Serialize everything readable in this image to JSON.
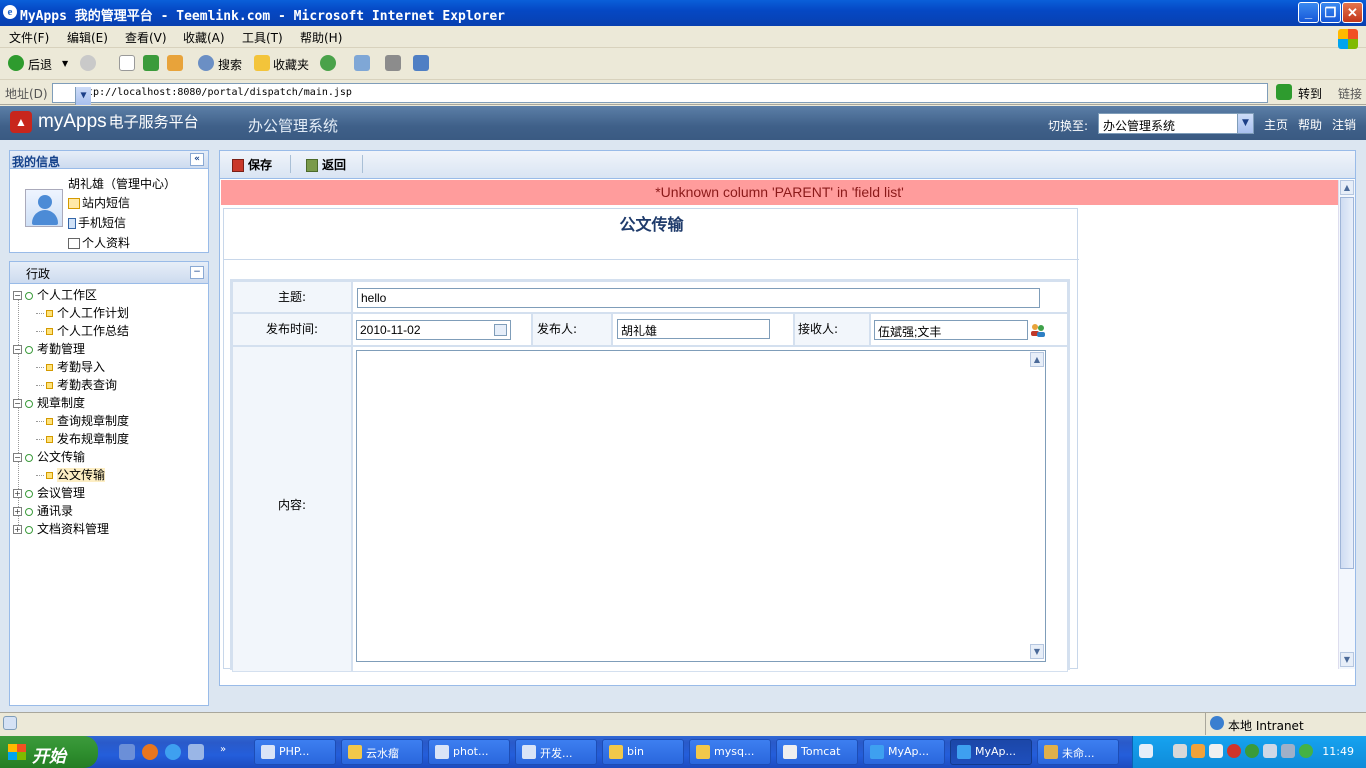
{
  "window": {
    "title": "MyApps 我的管理平台 - Teemlink.com - Microsoft Internet Explorer"
  },
  "menu": [
    "文件(F)",
    "编辑(E)",
    "查看(V)",
    "收藏(A)",
    "工具(T)",
    "帮助(H)"
  ],
  "toolbar": {
    "back": "后退",
    "search": "搜索",
    "favorites": "收藏夹"
  },
  "address": {
    "label": "地址(D)",
    "url": "http://localhost:8080/portal/dispatch/main.jsp",
    "go": "转到",
    "links": "链接"
  },
  "header": {
    "logo": "myApps",
    "logo_sub": "电子服务平台",
    "system_title": "办公管理系统",
    "switch_label": "切换至:",
    "switch_value": "办公管理系统",
    "links": {
      "home": "主页",
      "help": "帮助",
      "logout": "注销"
    }
  },
  "myinfo": {
    "title": "我的信息",
    "user": "胡礼雄（管理中心）",
    "site_msg": "站内短信",
    "mobile_msg": "手机短信",
    "profile": "个人资料"
  },
  "nav": {
    "title": "行政",
    "groups": [
      {
        "label": "个人工作区",
        "items": [
          "个人工作计划",
          "个人工作总结"
        ]
      },
      {
        "label": "考勤管理",
        "items": [
          "考勤导入",
          "考勤表查询"
        ]
      },
      {
        "label": "规章制度",
        "items": [
          "查询规章制度",
          "发布规章制度"
        ]
      },
      {
        "label": "公文传输",
        "items": [
          "公文传输"
        ]
      },
      {
        "label": "会议管理",
        "items": []
      },
      {
        "label": "通讯录",
        "items": []
      },
      {
        "label": "文档资料管理",
        "items": []
      }
    ]
  },
  "content": {
    "save": "保存",
    "back": "返回",
    "error": "*Unknown column 'PARENT' in 'field list'",
    "form_title": "公文传输",
    "subject_label": "主题:",
    "subject_value": "hello",
    "date_label": "发布时间:",
    "date_value": "2010-11-02",
    "publisher_label": "发布人:",
    "publisher_value": "胡礼雄",
    "receiver_label": "接收人:",
    "receiver_value": "伍斌强;文丰",
    "content_label": "内容:"
  },
  "status": {
    "zone": "本地 Intranet"
  },
  "taskbar": {
    "start": "开始",
    "tasks": [
      "PHP...",
      "云水瘤",
      "phot...",
      "开发...",
      "bin",
      "mysq...",
      "Tomcat",
      "MyAp...",
      "MyAp...",
      "未命..."
    ],
    "clock": "11:49"
  },
  "colors": {
    "accent": "#3f6089",
    "error_bg": "#ff9c9c",
    "panel_border": "#99bbe8"
  }
}
